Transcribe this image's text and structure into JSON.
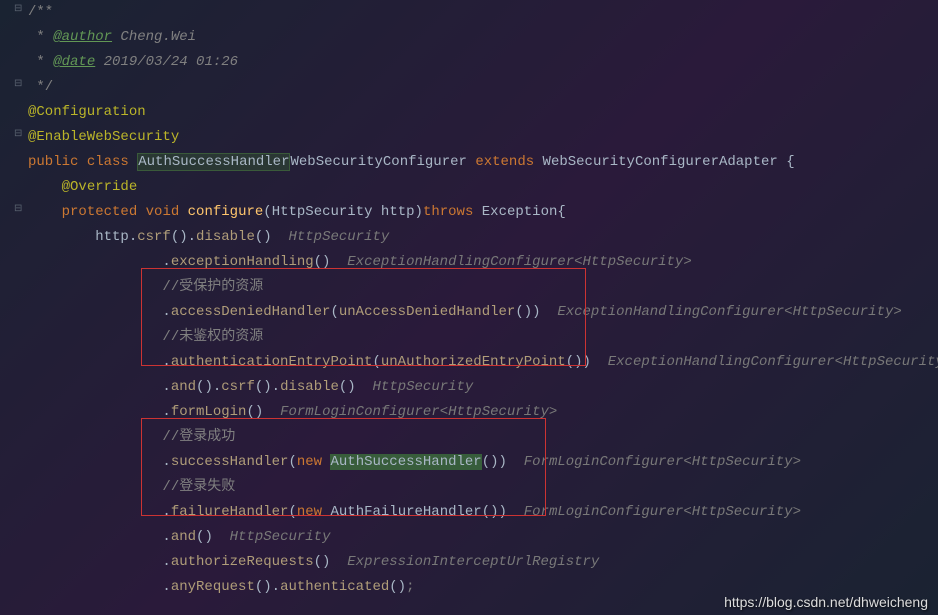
{
  "doc": {
    "open": "/**",
    "author_tag": "@author",
    "author_name": " Cheng.Wei",
    "date_tag": "@date",
    "date_value": " 2019/03/24 01:26",
    "close": " */",
    "prefix": " * "
  },
  "annotations": {
    "configuration": "@Configuration",
    "enableWebSecurity": "@EnableWebSecurity",
    "override": "@Override"
  },
  "keywords": {
    "public": "public",
    "class": "class",
    "extends": "extends",
    "protected": "protected",
    "void": "void",
    "throws": "throws",
    "new": "new"
  },
  "classes": {
    "authSuccessHandler": "AuthSuccessHandler",
    "webSecurityConfigurer": "WebSecurityConfigurer",
    "webSecurityConfigurerAdapter": "WebSecurityConfigurerAdapter",
    "httpSecurity": "HttpSecurity",
    "exception": "Exception",
    "authFailureHandler": "AuthFailureHandler"
  },
  "methods": {
    "configure": "configure"
  },
  "params": {
    "http": "http"
  },
  "hints": {
    "httpSecurity": "HttpSecurity",
    "exceptionHandling": "ExceptionHandlingConfigurer<HttpSecurity>",
    "formLogin": "FormLoginConfigurer<HttpSecurity>",
    "expression": "ExpressionInterceptUrlRegistry"
  },
  "calls": {
    "csrf": "csrf",
    "disable": "disable",
    "exceptionHandling": "exceptionHandling",
    "accessDeniedHandler": "accessDeniedHandler",
    "unAccessDeniedHandler": "unAccessDeniedHandler",
    "authenticationEntryPoint": "authenticationEntryPoint",
    "unAuthorizedEntryPoint": "unAuthorizedEntryPoint",
    "and": "and",
    "formLogin": "formLogin",
    "successHandler": "successHandler",
    "failureHandler": "failureHandler",
    "authorizeRequests": "authorizeRequests",
    "anyRequest": "anyRequest",
    "authenticated": "authenticated"
  },
  "comments": {
    "protected": "//受保护的资源",
    "unauthorized": "//未鉴权的资源",
    "loginSuccess": "//登录成功",
    "loginFail": "//登录失败"
  },
  "watermark": "https://blog.csdn.net/dhweicheng"
}
